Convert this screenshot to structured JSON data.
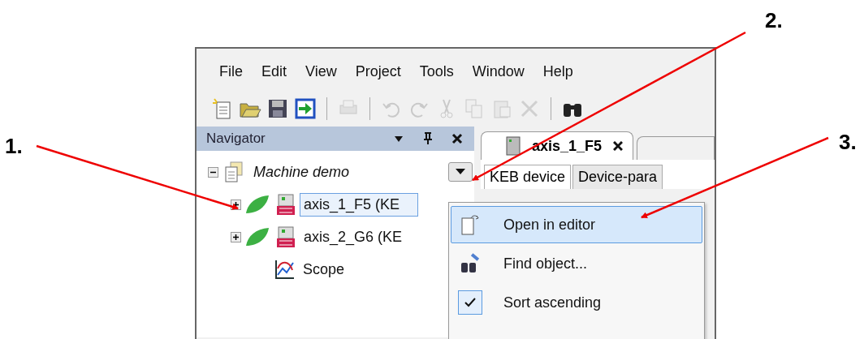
{
  "annotations": [
    {
      "label": "1.",
      "kind": "left"
    },
    {
      "label": "2.",
      "kind": "top"
    },
    {
      "label": "3.",
      "kind": "right"
    }
  ],
  "menu_bar": [
    "File",
    "Edit",
    "View",
    "Project",
    "Tools",
    "Window",
    "Help"
  ],
  "toolbar": [
    {
      "kind": "new",
      "disabled": false
    },
    {
      "kind": "open",
      "disabled": false
    },
    {
      "kind": "save",
      "disabled": false
    },
    {
      "kind": "import",
      "disabled": false
    },
    {
      "kind": "sep"
    },
    {
      "kind": "print",
      "disabled": true
    },
    {
      "kind": "sep"
    },
    {
      "kind": "undo",
      "disabled": true
    },
    {
      "kind": "redo",
      "disabled": true
    },
    {
      "kind": "cut",
      "disabled": true
    },
    {
      "kind": "copy",
      "disabled": true
    },
    {
      "kind": "paste",
      "disabled": true
    },
    {
      "kind": "delete",
      "disabled": true
    },
    {
      "kind": "sep"
    },
    {
      "kind": "find",
      "disabled": false
    }
  ],
  "navigator": {
    "title": "Navigator",
    "tree": [
      {
        "label": "Machine demo",
        "kind": "project",
        "expanded": true,
        "selected": false,
        "children": [
          {
            "label": "axis_1_F5 (KE",
            "kind": "device",
            "expanded": false,
            "selected": true
          },
          {
            "label": "axis_2_G6 (KE",
            "kind": "device",
            "expanded": false,
            "selected": false
          },
          {
            "label": "Scope",
            "kind": "scope",
            "selected": false
          }
        ]
      }
    ]
  },
  "editor": {
    "tab": "axis_1_F5",
    "subtabs": [
      {
        "label": "KEB device",
        "selected": true
      },
      {
        "label": "Device-para",
        "selected": false
      }
    ]
  },
  "context_menu": [
    {
      "label": "Open in editor",
      "kind": "open",
      "selected": true
    },
    {
      "label": "Find object...",
      "kind": "find",
      "selected": false
    },
    {
      "label": "Sort ascending",
      "kind": "check",
      "checked": true,
      "selected": false
    }
  ]
}
